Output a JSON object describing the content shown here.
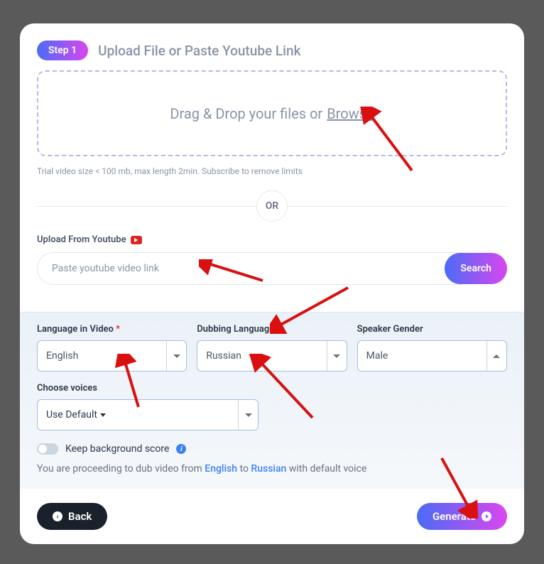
{
  "step": {
    "badge": "Step 1",
    "title": "Upload File or Paste Youtube Link"
  },
  "dropzone": {
    "text": "Drag & Drop your files or",
    "browse": "Browse"
  },
  "trial_note": "Trial video size < 100 mb, max length 2min. Subscribe to remove limits",
  "or": "OR",
  "youtube": {
    "label": "Upload From Youtube",
    "placeholder": "Paste youtube video link",
    "search_btn": "Search"
  },
  "fields": {
    "language_in_video": {
      "label": "Language in Video",
      "required": true,
      "value": "English"
    },
    "dubbing_language": {
      "label": "Dubbing Language",
      "required": true,
      "value": "Russian"
    },
    "speaker_gender": {
      "label": "Speaker Gender",
      "required": false,
      "value": "Male"
    },
    "choose_voices": {
      "label": "Choose voices",
      "value": "Use Default"
    }
  },
  "toggle": {
    "label": "Keep background score"
  },
  "proceed": {
    "prefix": "You are proceeding to dub video from ",
    "from": "English",
    "mid": " to ",
    "to": "Russian",
    "suffix": " with default voice"
  },
  "footer": {
    "back": "Back",
    "generate": "Generate"
  }
}
